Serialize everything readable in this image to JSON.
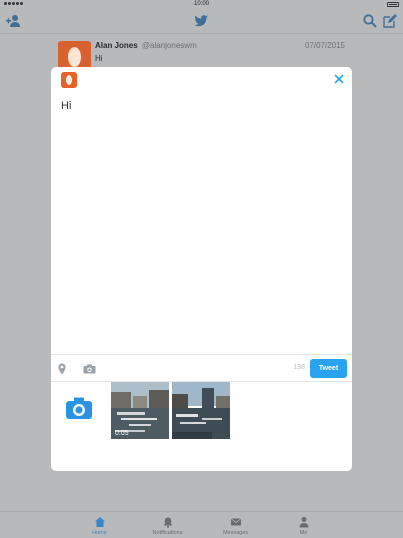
{
  "status_bar": {
    "time": "10:00"
  },
  "timeline": {
    "tweet": {
      "name": "Alan Jones",
      "handle": "@alanjoneswm",
      "date": "07/07/2015",
      "text": "Hi"
    }
  },
  "compose": {
    "text": "Hi",
    "char_count": "138",
    "tweet_label": "Tweet",
    "attachments": [
      {
        "duration": "0:05"
      },
      {
        "duration": ""
      }
    ]
  },
  "tabbar": {
    "items": [
      {
        "label": "Home",
        "icon": "home-icon",
        "active": true
      },
      {
        "label": "Notifications",
        "icon": "bell-icon",
        "active": false
      },
      {
        "label": "Messages",
        "icon": "envelope-icon",
        "active": false
      },
      {
        "label": "Me",
        "icon": "person-icon",
        "active": false
      }
    ]
  },
  "colors": {
    "accent": "#2aa3ef",
    "avatar": "#e8602a",
    "overlay": "#b8b9bb"
  }
}
